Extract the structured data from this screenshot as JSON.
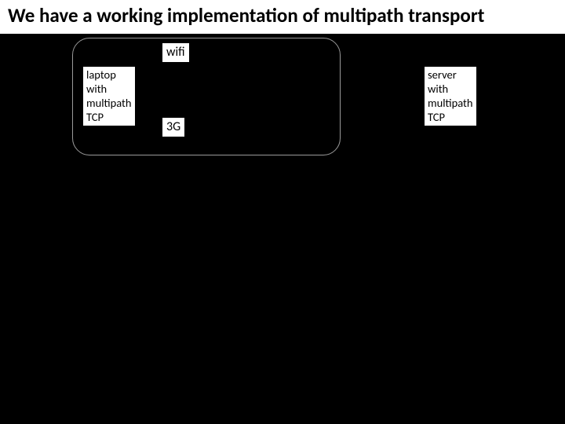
{
  "title": "We have a working implementation of multipath transport",
  "diagram": {
    "wifi_label": "wifi",
    "threeg_label": "3G",
    "laptop_label": "laptop\nwith\nmultipath\nTCP",
    "server_label": "server\nwith\nmultipath\nTCP"
  }
}
